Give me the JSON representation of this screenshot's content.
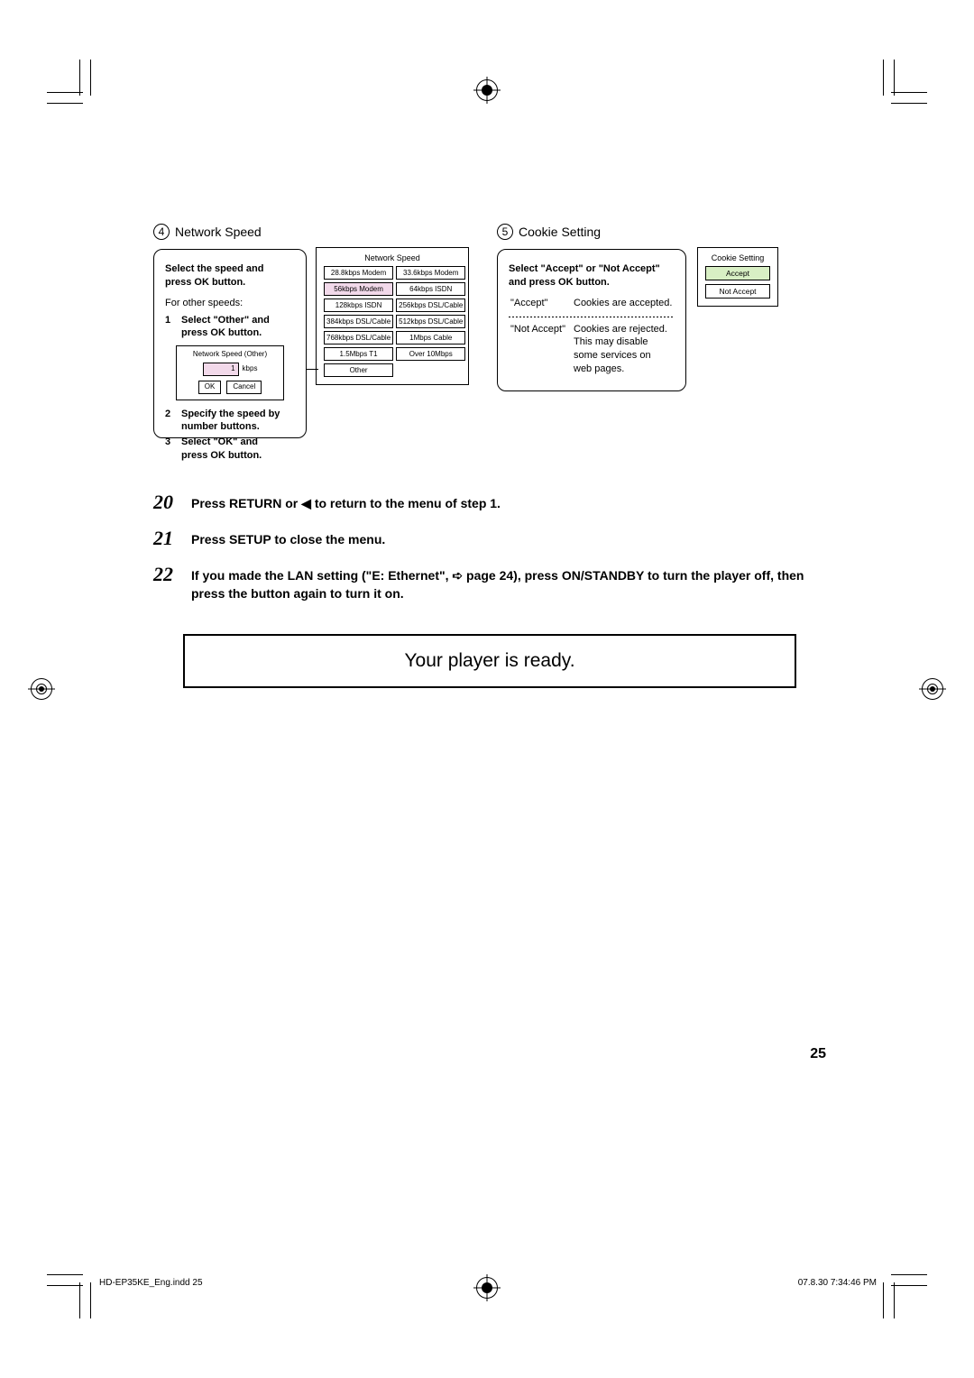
{
  "section4": {
    "num": "4",
    "title": "Network Speed",
    "box1_line1": "Select the speed and",
    "box1_line2": "press OK button.",
    "for_other": "For other speeds:",
    "step1a": "Select \"Other\" and",
    "step1b": "press OK button.",
    "step2a": "Specify the speed by",
    "step2b": "number buttons.",
    "step3a": "Select \"OK\" and",
    "step3b": "press OK button.",
    "other_panel_title": "Network Speed (Other)",
    "other_value": "1",
    "other_unit": "kbps",
    "other_ok": "OK",
    "other_cancel": "Cancel",
    "speed_panel_title": "Network Speed",
    "speeds": [
      "28.8kbps Modem",
      "33.6kbps Modem",
      "56kbps Modem",
      "64kbps ISDN",
      "128kbps ISDN",
      "256kbps DSL/Cable",
      "384kbps DSL/Cable",
      "512kbps DSL/Cable",
      "768kbps DSL/Cable",
      "1Mbps Cable",
      "1.5Mbps T1",
      "Over 10Mbps",
      "Other"
    ]
  },
  "section5": {
    "num": "5",
    "title": "Cookie Setting",
    "box_line1": "Select \"Accept\" or \"Not Accept\"",
    "box_line2": "and press OK button.",
    "accept_label": "\"Accept\"",
    "accept_desc": "Cookies are accepted.",
    "not_label": "\"Not Accept\"",
    "not_desc1": "Cookies are rejected.",
    "not_desc2": "This may disable",
    "not_desc3": "some services on",
    "not_desc4": "web pages.",
    "panel_title": "Cookie Setting",
    "opt_accept": "Accept",
    "opt_not": "Not Accept"
  },
  "steps": {
    "n20": "20",
    "t20_a": "Press RETURN or ",
    "t20_b": " to return to the menu of step 1.",
    "n21": "21",
    "t21": "Press SETUP to close the menu.",
    "n22": "22",
    "t22_a": "If you made the LAN setting (\"E: Ethernet\", ",
    "t22_page": " page 24), press ON/STANDBY to turn the player off, then press the button again to turn it on."
  },
  "ready": "Your player is ready.",
  "pagenum": "25",
  "footer_left": "HD-EP35KE_Eng.indd   25",
  "footer_right": "07.8.30   7:34:46 PM"
}
